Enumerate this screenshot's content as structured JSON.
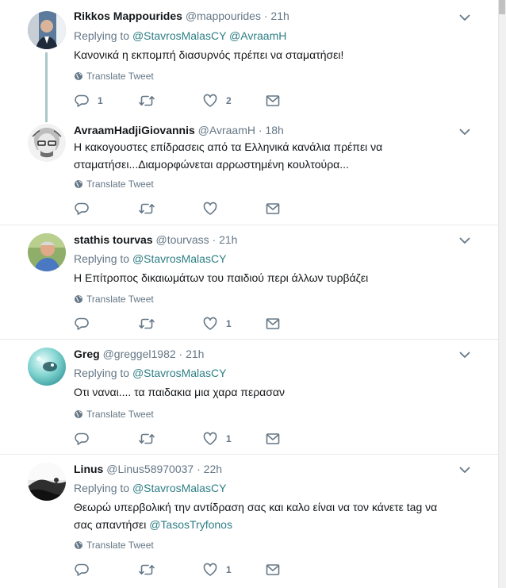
{
  "tweets": [
    {
      "name": "Rikkos Mappourides",
      "handle": "@mappourides",
      "time": "21h",
      "replying_label": "Replying to",
      "mentions": [
        "@StavrosMalasCY",
        "@AvraamH"
      ],
      "text": "Κανονικά η εκπομπή διασυρνός πρέπει να σταματήσει!",
      "translate": "Translate Tweet",
      "reply_count": "1",
      "retweet_count": "",
      "like_count": "2"
    },
    {
      "name": "AvraamHadjiGiovannis",
      "handle": "@AvraamH",
      "time": "18h",
      "text_line1": "Η κακογουστες επίδρασεις από τα Ελληνικά κανάλια πρέπει να",
      "text_line2": "σταματήσει...Διαμορφώνεται αρρωστημένη κουλτούρα...",
      "translate": "Translate Tweet",
      "reply_count": "",
      "retweet_count": "",
      "like_count": ""
    },
    {
      "name": "stathis tourvas",
      "handle": "@tourvass",
      "time": "21h",
      "replying_label": "Replying to",
      "mentions": [
        "@StavrosMalasCY"
      ],
      "text": "Η Επίτροπος δικαιωμάτων του παιδιού περι άλλων τυρβάζει",
      "translate": "Translate Tweet",
      "reply_count": "",
      "retweet_count": "",
      "like_count": "1"
    },
    {
      "name": "Greg",
      "handle": "@greggel1982",
      "time": "21h",
      "replying_label": "Replying to",
      "mentions": [
        "@StavrosMalasCY"
      ],
      "text": "Οτι ναναι.... τα παιδακια μια χαρα περασαν",
      "translate": "Translate Tweet",
      "reply_count": "",
      "retweet_count": "",
      "like_count": "1"
    },
    {
      "name": "Linus",
      "handle": "@Linus58970037",
      "time": "22h",
      "replying_label": "Replying to",
      "mentions": [
        "@StavrosMalasCY"
      ],
      "text_line1": "Θεωρώ υπερβολική την αντίδραση σας και καλο είναι να τον κάνετε tag να",
      "text_line2_prefix": "σας απαντήσει",
      "text_line2_mention": "@TasosTryfonos",
      "translate": "Translate Tweet",
      "reply_count": "",
      "retweet_count": "",
      "like_count": "1"
    }
  ],
  "dot": "·",
  "colors": {
    "mention": "#2e7e85",
    "muted": "#657786",
    "separator": "#e6ecf0",
    "thread": "#a9c7c9"
  },
  "icons": [
    "reply-icon",
    "retweet-icon",
    "like-icon",
    "direct-message-icon",
    "globe-icon",
    "chevron-down-icon"
  ]
}
